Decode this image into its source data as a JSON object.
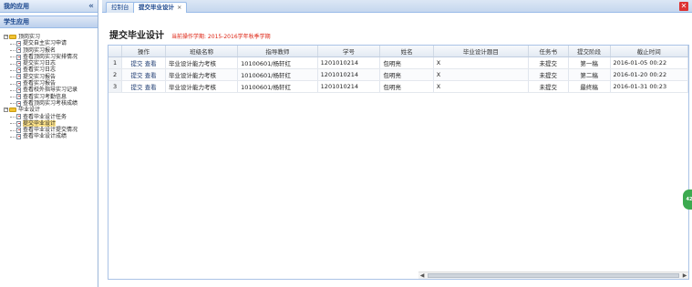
{
  "left": {
    "header": "我的应用",
    "collapse_icon": "«",
    "app_title": "学生应用",
    "tree": [
      {
        "label": "顶岗实习",
        "level": 1,
        "folder": true,
        "expanded": true
      },
      {
        "label": "提交自主实习申请",
        "level": 2
      },
      {
        "label": "顶岗实习报名",
        "level": 2
      },
      {
        "label": "查看顶岗实习安排情况",
        "level": 2
      },
      {
        "label": "提交实习日志",
        "level": 2
      },
      {
        "label": "查看实习日志",
        "level": 2
      },
      {
        "label": "提交实习报告",
        "level": 2
      },
      {
        "label": "查看实习报告",
        "level": 2
      },
      {
        "label": "查看校外指导实习记录",
        "level": 2
      },
      {
        "label": "查看实习考勤信息",
        "level": 2
      },
      {
        "label": "查看顶岗实习考核成绩",
        "level": 2
      },
      {
        "label": "毕业设计",
        "level": 1,
        "folder": true,
        "expanded": true
      },
      {
        "label": "查看毕业设计任务",
        "level": 2
      },
      {
        "label": "提交毕业设计",
        "level": 2,
        "selected": true
      },
      {
        "label": "查看毕业设计提交情况",
        "level": 2
      },
      {
        "label": "查看毕业设计成绩",
        "level": 2
      }
    ]
  },
  "tabs": [
    {
      "label": "控制台",
      "active": false
    },
    {
      "label": "提交毕业设计",
      "active": true,
      "close": "×"
    }
  ],
  "close_all_icon": "✕",
  "page": {
    "title": "提交毕业设计",
    "subtitle": "当前操作学期: 2015-2016学年秋季学期"
  },
  "table": {
    "columns": [
      "",
      "操作",
      "班级名称",
      "指导教师",
      "学号",
      "姓名",
      "毕业设计题目",
      "任务书",
      "提交阶段",
      "截止时间"
    ],
    "rows": [
      {
        "num": "1",
        "op_submit": "提交",
        "op_view": "查看",
        "class_name": "毕业设计能力考核",
        "teacher": "10100601/杨轩红",
        "student_no": "1201010214",
        "name": "包明亮",
        "topic": "X",
        "task": "未提交",
        "stage": "第一稿",
        "deadline": "2016-01-05 00:22"
      },
      {
        "num": "2",
        "op_submit": "提交",
        "op_view": "查看",
        "class_name": "毕业设计能力考核",
        "teacher": "10100601/杨轩红",
        "student_no": "1201010214",
        "name": "包明亮",
        "topic": "X",
        "task": "未提交",
        "stage": "第二稿",
        "deadline": "2016-01-20 00:22"
      },
      {
        "num": "3",
        "op_submit": "提交",
        "op_view": "查看",
        "class_name": "毕业设计能力考核",
        "teacher": "10100601/杨轩红",
        "student_no": "1201010214",
        "name": "包明亮",
        "topic": "X",
        "task": "未提交",
        "stage": "最终稿",
        "deadline": "2016-01-31 00:23"
      }
    ]
  },
  "scroll": {
    "left_arrow": "◀",
    "right_arrow": "▶"
  },
  "float_button": "42"
}
